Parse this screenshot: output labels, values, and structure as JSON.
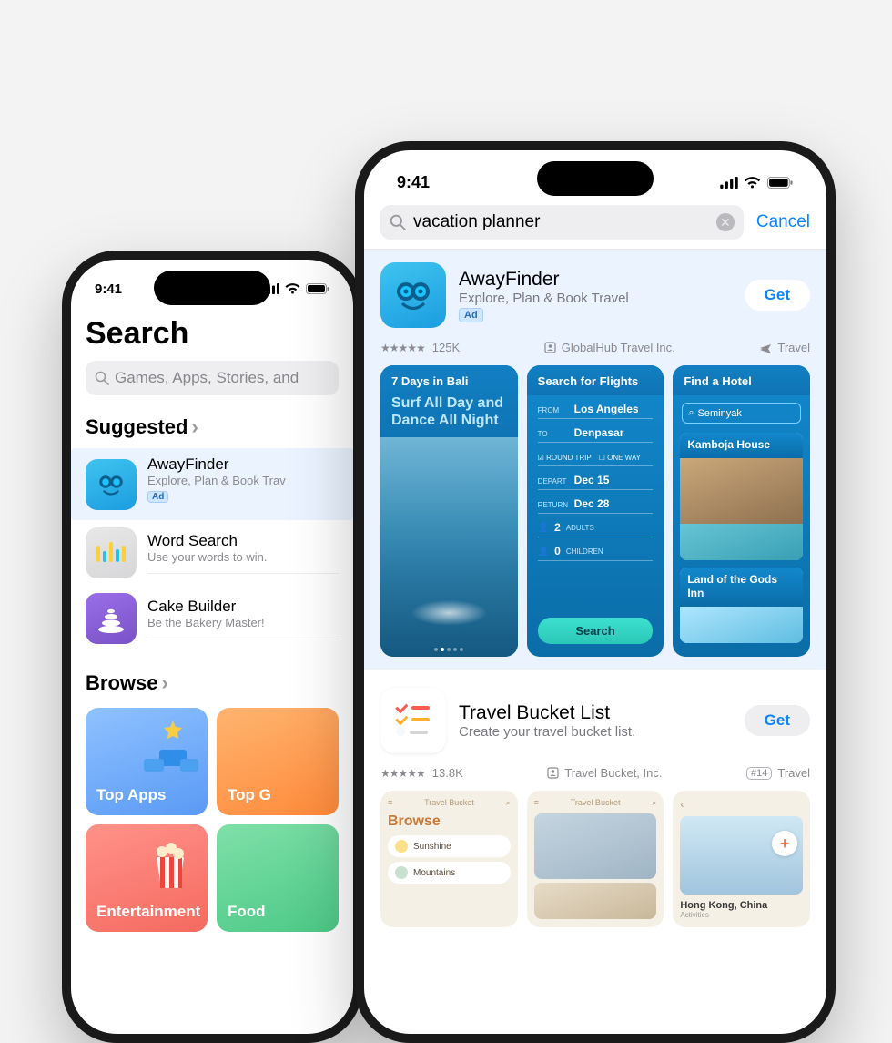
{
  "status": {
    "time": "9:41"
  },
  "left": {
    "title": "Search",
    "search_placeholder": "Games, Apps, Stories, and",
    "suggested_label": "Suggested",
    "browse_label": "Browse",
    "suggested": [
      {
        "name": "AwayFinder",
        "sub": "Explore, Plan & Book Trav",
        "ad": true,
        "ad_label": "Ad"
      },
      {
        "name": "Word Search",
        "sub": "Use your words to win."
      },
      {
        "name": "Cake Builder",
        "sub": "Be the Bakery Master!"
      }
    ],
    "browse": [
      {
        "label": "Top Apps"
      },
      {
        "label": "Top G"
      },
      {
        "label": "Entertainment"
      },
      {
        "label": "Food"
      }
    ]
  },
  "right": {
    "search_value": "vacation planner",
    "cancel_label": "Cancel",
    "result1": {
      "name": "AwayFinder",
      "sub": "Explore, Plan & Book Travel",
      "ad_label": "Ad",
      "get_label": "Get",
      "ratings": "125K",
      "developer": "GlobalHub Travel Inc.",
      "category": "Travel",
      "shot1": {
        "tag": "7 Days in Bali",
        "title": "Surf All Day and Dance All Night"
      },
      "shot2": {
        "header": "Search for Flights",
        "from_lbl": "FROM",
        "from": "Los Angeles",
        "to_lbl": "TO",
        "to": "Denpasar",
        "roundtrip": "ROUND TRIP",
        "oneway": "ONE WAY",
        "depart_lbl": "DEPART",
        "depart": "Dec 15",
        "return_lbl": "RETURN",
        "return": "Dec 28",
        "adults_n": "2",
        "adults": "ADULTS",
        "children_n": "0",
        "children": "CHILDREN",
        "btn": "Search"
      },
      "shot3": {
        "header": "Find a Hotel",
        "search": "Seminyak",
        "hotel1": "Kamboja House",
        "hotel2": "Land of the Gods Inn"
      }
    },
    "result2": {
      "name": "Travel Bucket List",
      "sub": "Create your travel bucket list.",
      "get_label": "Get",
      "ratings": "13.8K",
      "developer": "Travel Bucket, Inc.",
      "rank": "#14",
      "category": "Travel",
      "shot1": {
        "brand": "Travel Bucket",
        "title": "Browse",
        "pill1": "Sunshine",
        "pill2": "Mountains"
      },
      "shot2": {
        "brand": "Travel Bucket"
      },
      "shot3": {
        "add": "Add Activity",
        "city": "Hong Kong, China",
        "sub": "Activities"
      }
    }
  }
}
